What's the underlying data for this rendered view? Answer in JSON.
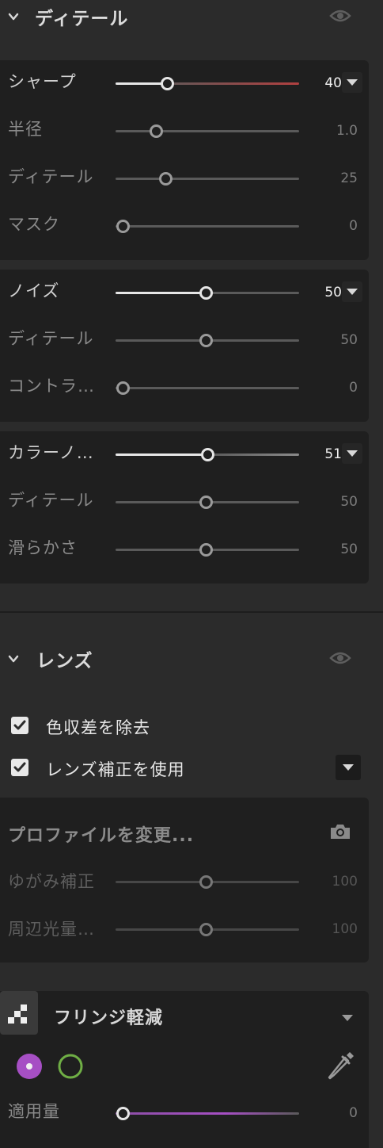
{
  "detail": {
    "title": "ディテール",
    "sharpen": {
      "label": "シャープ",
      "value": "40",
      "amount": 0.28,
      "subs": [
        {
          "label": "半径",
          "value": "1.0",
          "amount": 0.22
        },
        {
          "label": "ディテール",
          "value": "25",
          "amount": 0.27
        },
        {
          "label": "マスク",
          "value": "0",
          "amount": 0.04
        }
      ]
    },
    "noise": {
      "label": "ノイズ",
      "value": "50",
      "amount": 0.5,
      "subs": [
        {
          "label": "ディテール",
          "value": "50",
          "amount": 0.5
        },
        {
          "label": "コントラ…",
          "value": "0",
          "amount": 0.04
        }
      ]
    },
    "color_noise": {
      "label": "カラーノ…",
      "value": "51",
      "amount": 0.51,
      "subs": [
        {
          "label": "ディテール",
          "value": "50",
          "amount": 0.5
        },
        {
          "label": "滑らかさ",
          "value": "50",
          "amount": 0.5
        }
      ]
    }
  },
  "lens": {
    "title": "レンズ",
    "remove_ca": {
      "label": "色収差を除去",
      "checked": true
    },
    "use_profile": {
      "label": "レンズ補正を使用",
      "checked": true
    },
    "profile": {
      "title": "プロファイルを変更...",
      "subs": [
        {
          "label": "ゆがみ補正",
          "value": "100",
          "amount": 0.5
        },
        {
          "label": "周辺光量…",
          "value": "100",
          "amount": 0.5
        }
      ]
    },
    "defringe": {
      "title": "フリンジ軽減",
      "amount_label": "適用量",
      "amount_value": "0",
      "amount": 0.04
    }
  },
  "colors": {
    "background": "#2b2b2b",
    "panel": "#1f1f1f",
    "sharpen_accent": "#b04040",
    "purple": "#a64fc4",
    "green": "#6fae45"
  }
}
